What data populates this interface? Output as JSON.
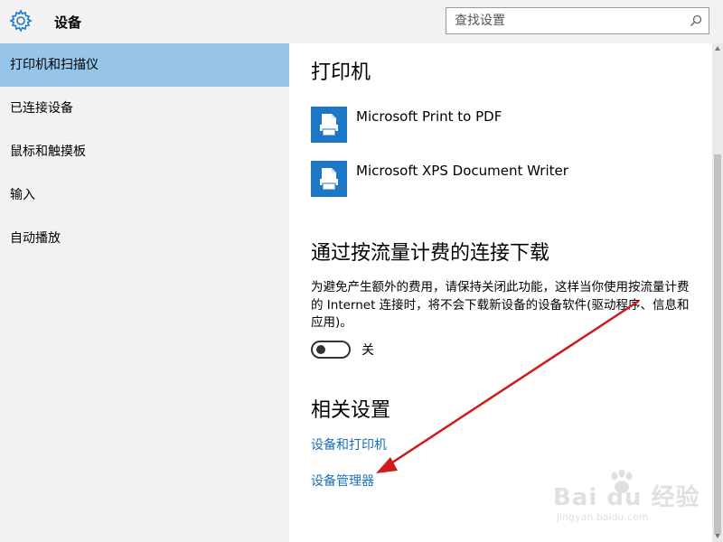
{
  "header": {
    "title": "设备",
    "search_placeholder": "查找设置",
    "icon": "gear-icon",
    "search_icon": "search-icon"
  },
  "sidebar": {
    "items": [
      {
        "label": "打印机和扫描仪",
        "active": true
      },
      {
        "label": "已连接设备",
        "active": false
      },
      {
        "label": "鼠标和触摸板",
        "active": false
      },
      {
        "label": "输入",
        "active": false
      },
      {
        "label": "自动播放",
        "active": false
      }
    ]
  },
  "main": {
    "printers_heading": "打印机",
    "printers": [
      {
        "name": "Microsoft Print to PDF",
        "icon": "printer-icon"
      },
      {
        "name": "Microsoft XPS Document Writer",
        "icon": "printer-icon"
      }
    ],
    "metered_heading": "通过按流量计费的连接下载",
    "metered_description": "为避免产生额外的费用，请保持关闭此功能，这样当你使用按流量计费的 Internet 连接时，将不会下载新设备的设备软件(驱动程序、信息和应用)。",
    "toggle": {
      "state": "off",
      "label": "关"
    },
    "related_heading": "相关设置",
    "links": [
      "设备和打印机",
      "设备管理器"
    ]
  },
  "watermark": {
    "brand": "Bai du 经验",
    "url": "jingyan.baidu.com"
  },
  "colors": {
    "sidebar_bg": "#f2f2f2",
    "active_item": "#96c5e9",
    "accent": "#1e78c6",
    "link": "#1a6fbd",
    "annotation_arrow": "#d11a1a"
  }
}
